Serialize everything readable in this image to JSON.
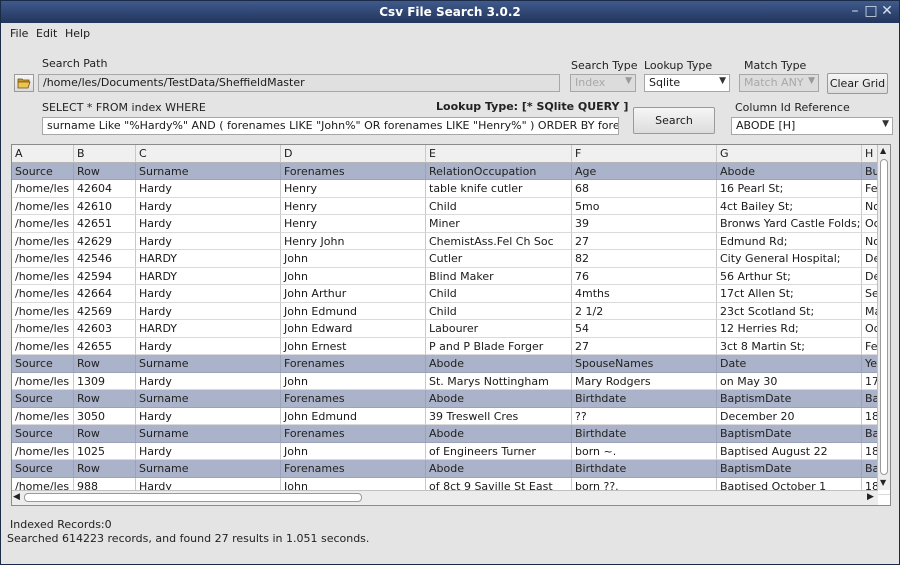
{
  "window": {
    "title": "Csv File Search 3.0.2",
    "controls": {
      "minimize": "–",
      "maximize": "□",
      "close": "✕"
    }
  },
  "menu": [
    "File",
    "Edit",
    "Help"
  ],
  "search_path": {
    "label": "Search Path",
    "value": "/home/les/Documents/TestData/SheffieldMaster"
  },
  "search_type": {
    "label": "Search Type",
    "value": "Index"
  },
  "lookup_type": {
    "label": "Lookup Type",
    "value": "Sqlite"
  },
  "match_type": {
    "label": "Match Type",
    "value": "Match ANY"
  },
  "clear_grid": "Clear Grid",
  "query": {
    "prefix": "SELECT * FROM index WHERE",
    "banner": "Lookup Type: [* SQlite QUERY ]",
    "value": "surname Like \"%Hardy%\" AND ( forenames LIKE \"John%\" OR forenames LIKE \"Henry%\" ) ORDER BY forenames"
  },
  "search_button": "Search",
  "column_ref": {
    "label": "Column Id Reference",
    "value": "ABODE [H]"
  },
  "grid": {
    "columns": [
      "A",
      "B",
      "C",
      "D",
      "E",
      "F",
      "G",
      "H"
    ],
    "rows": [
      {
        "kind": "sub",
        "cells": [
          "Source",
          "Row",
          "Surname",
          "Forenames",
          "RelationOccupation",
          "Age",
          "Abode",
          "Bu"
        ]
      },
      {
        "kind": "data",
        "cells": [
          "/home/les",
          "42604",
          "Hardy",
          "Henry",
          "table knife cutler",
          "68",
          "16 Pearl St;",
          "Feb"
        ]
      },
      {
        "kind": "data",
        "cells": [
          "/home/les",
          "42610",
          "Hardy",
          "Henry",
          "Child",
          "5mo",
          "4ct Bailey St;",
          "No"
        ]
      },
      {
        "kind": "data",
        "cells": [
          "/home/les",
          "42651",
          "Hardy",
          "Henry",
          "Miner",
          "39",
          "Bronws Yard Castle Folds;",
          "Oc"
        ]
      },
      {
        "kind": "data",
        "cells": [
          "/home/les",
          "42629",
          "Hardy",
          "Henry John",
          "ChemistAss.Fel Ch Soc",
          "27",
          "Edmund Rd;",
          "No"
        ]
      },
      {
        "kind": "data",
        "cells": [
          "/home/les",
          "42546",
          "HARDY",
          "John",
          "Cutler",
          "82",
          "City General Hospital;",
          "De"
        ]
      },
      {
        "kind": "data",
        "cells": [
          "/home/les",
          "42594",
          "HARDY",
          "John",
          "Blind Maker",
          "76",
          "56 Arthur St;",
          "De"
        ]
      },
      {
        "kind": "data",
        "cells": [
          "/home/les",
          "42664",
          "Hardy",
          "John Arthur",
          "Child",
          "4mths",
          "17ct Allen St;",
          "Se"
        ]
      },
      {
        "kind": "data",
        "cells": [
          "/home/les",
          "42569",
          "Hardy",
          "John Edmund",
          "Child",
          "2  1/2",
          "23ct Scotland St;",
          "Ma"
        ]
      },
      {
        "kind": "data",
        "cells": [
          "/home/les",
          "42603",
          "HARDY",
          "John Edward",
          "Labourer",
          "54",
          "12 Herries Rd;",
          "Oc"
        ]
      },
      {
        "kind": "data",
        "cells": [
          "/home/les",
          "42655",
          "Hardy",
          "John Ernest",
          "P and P Blade Forger",
          "27",
          "3ct 8 Martin St;",
          "Feb"
        ]
      },
      {
        "kind": "sub",
        "cells": [
          "Source",
          "Row",
          "Surname",
          "Forenames",
          "Abode",
          "SpouseNames",
          "Date",
          "Yea"
        ]
      },
      {
        "kind": "data",
        "cells": [
          "/home/les",
          "1309",
          "Hardy",
          "John",
          "St. Marys Nottingham",
          "Mary Rodgers",
          "on May 30",
          "17"
        ]
      },
      {
        "kind": "sub",
        "cells": [
          "Source",
          "Row",
          "Surname",
          "Forenames",
          "Abode",
          "Birthdate",
          "BaptismDate",
          "Ba"
        ]
      },
      {
        "kind": "data",
        "cells": [
          "/home/les",
          "3050",
          "Hardy",
          "John Edmund",
          "39 Treswell Cres",
          "??",
          "December 20",
          "18"
        ]
      },
      {
        "kind": "sub",
        "cells": [
          "Source",
          "Row",
          "Surname",
          "Forenames",
          "Abode",
          "Birthdate",
          "BaptismDate",
          "Ba"
        ]
      },
      {
        "kind": "data",
        "cells": [
          "/home/les",
          "1025",
          "Hardy",
          "John",
          "of Engineers Turner",
          "born ~.",
          "Baptised August 22",
          "18"
        ]
      },
      {
        "kind": "sub",
        "cells": [
          "Source",
          "Row",
          "Surname",
          "Forenames",
          "Abode",
          "Birthdate",
          "BaptismDate",
          "Ba"
        ]
      },
      {
        "kind": "data",
        "cells": [
          "/home/les",
          "988",
          "Hardy",
          "John",
          "of 8ct 9 Saville St East",
          "born ??.",
          "Baptised October 1",
          "18"
        ]
      }
    ]
  },
  "status": {
    "indexed": "Indexed Records:0",
    "summary": "Searched 614223  records, and found 27 results in 1.051 seconds."
  }
}
